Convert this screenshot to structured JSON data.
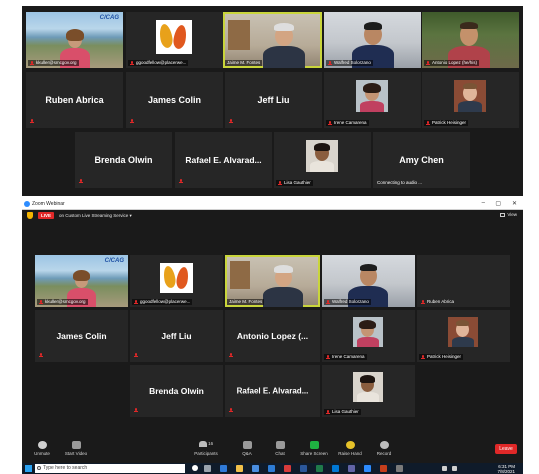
{
  "top_gallery": {
    "tiles": [
      {
        "id": "t1",
        "name": "kkuller@smcgov.org",
        "label": "C/CAG"
      },
      {
        "id": "t2",
        "name": "ggoodfellow@placerwe..."
      },
      {
        "id": "t3",
        "name": "Jaime M. Fontes"
      },
      {
        "id": "t4",
        "name": "Walfred Solorzano"
      },
      {
        "id": "t5",
        "name": "Antonio Lopez (he/his)"
      },
      {
        "id": "t6",
        "name": "Ruben Abrica"
      },
      {
        "id": "t7",
        "name": "James Colin"
      },
      {
        "id": "t8",
        "name": "Jeff Liu"
      },
      {
        "id": "t9",
        "name": "Irene Camarena"
      },
      {
        "id": "t10",
        "name": "Patrick Heisinger"
      },
      {
        "id": "t11",
        "name": "Brenda Olwin"
      },
      {
        "id": "t12",
        "name": "Rafael E. Alvarad..."
      },
      {
        "id": "t13",
        "name": "Lisa Gauthier"
      },
      {
        "id": "t14",
        "name": "Amy Chen",
        "status": "Connecting to audio ..."
      }
    ]
  },
  "window": {
    "title": "Zoom Webinar",
    "controls": {
      "minimize": "–",
      "maximize": "▢",
      "close": "✕"
    },
    "live_badge": "LIVE",
    "live_text": "on Custom Live Streaming Service ▾",
    "view_label": "View"
  },
  "bottom_gallery": {
    "tiles": [
      {
        "id": "b1",
        "name": "kkuller@smcgov.org",
        "label": "C/CAG"
      },
      {
        "id": "b2",
        "name": "ggoodfellow@placerwe..."
      },
      {
        "id": "b3",
        "name": "Jaime M. Fontes"
      },
      {
        "id": "b4",
        "name": "Walfred Solorzano"
      },
      {
        "id": "b5",
        "name": "Ruben Abrica"
      },
      {
        "id": "b6",
        "name": "James Colin"
      },
      {
        "id": "b7",
        "name": "Jeff Liu"
      },
      {
        "id": "b8",
        "name": "Antonio Lopez (..."
      },
      {
        "id": "b9",
        "name": "Irene Camarena"
      },
      {
        "id": "b10",
        "name": "Patrick Heisinger"
      },
      {
        "id": "b11",
        "name": "Brenda Olwin"
      },
      {
        "id": "b12",
        "name": "Rafael E. Alvarad..."
      },
      {
        "id": "b13",
        "name": "Lisa Gauthier"
      }
    ]
  },
  "toolbar": {
    "unmute": "Unmute",
    "start_video": "Start Video",
    "participants": "Participants",
    "participants_count": "16",
    "qa": "Q&A",
    "chat": "Chat",
    "share_screen": "Share Screen",
    "raise_hand": "Raise Hand",
    "record": "Record",
    "leave": "Leave"
  },
  "taskbar": {
    "search_placeholder": "Type here to search",
    "time": "6:31 PM",
    "date": "7/8/2021"
  },
  "colors": {
    "active_speaker": "#c9d53b",
    "muted_mic": "#e02828",
    "live_red": "#e02828",
    "zoom_blue": "#2d8cff"
  }
}
